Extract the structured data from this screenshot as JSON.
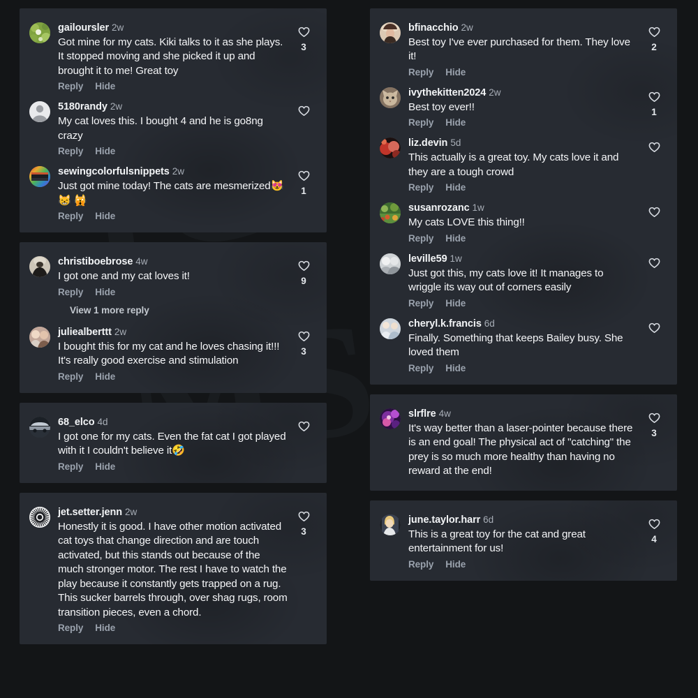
{
  "theme": {
    "page_bg": "#131517",
    "card_bg": "#272b32",
    "text_color": "#f4f5f7",
    "muted_color": "#9aa2ad",
    "username_color": "#f2f4f6"
  },
  "labels": {
    "reply": "Reply",
    "hide": "Hide",
    "view_more_reply": "View 1 more reply",
    "like_icon": "heart-icon"
  },
  "left_column": {
    "cards": [
      {
        "comments": [
          {
            "username": "gailoursler",
            "time": "2w",
            "text": "Got mine for my cats. Kiki talks to it as she plays. It stopped moving and she picked it up and brought it to me! Great toy",
            "likes": "3",
            "avatar": "leaves-photo",
            "has_actions": true
          },
          {
            "username": "5180randy",
            "time": "2w",
            "text": "My cat loves this. I bought 4 and he is go8ng crazy",
            "likes": "",
            "avatar": "default-person",
            "has_actions": true
          },
          {
            "username": "sewingcolorfulsnippets",
            "time": "2w",
            "text": "Just got mine today! The cats are mesmerized😻 😸 🙀",
            "likes": "1",
            "avatar": "rainbow-ring-photo",
            "has_actions": true
          }
        ]
      },
      {
        "comments": [
          {
            "username": "christiboebrose",
            "time": "4w",
            "text": "I got one and my cat loves it!",
            "likes": "9",
            "avatar": "dark-photo",
            "has_actions": true,
            "view_more": true
          },
          {
            "username": "juliealberttt",
            "time": "2w",
            "text": "I bought this for my cat and he loves chasing it!!! It's really good exercise and stimulation",
            "likes": "3",
            "avatar": "couple-photo",
            "has_actions": true
          }
        ]
      },
      {
        "comments": [
          {
            "username": "68_elco",
            "time": "4d",
            "text": "I got one for my cats. Even the fat cat I got played with it I couldn't believe it🤣",
            "likes": "",
            "avatar": "car-photo",
            "has_actions": true
          }
        ]
      },
      {
        "comments": [
          {
            "username": "jet.setter.jenn",
            "time": "2w",
            "text": "Honestly it is good. I have other motion activated cat toys that change direction and are touch activated, but this stands out because of the much stronger motor. The rest I have to watch the play because it constantly gets trapped on a rug. This sucker barrels through, over shag rugs, room transition pieces, even a chord.",
            "likes": "3",
            "avatar": "sunburst-logo",
            "has_actions": true
          }
        ]
      }
    ]
  },
  "right_column": {
    "cards": [
      {
        "comments": [
          {
            "username": "bfinacchio",
            "time": "2w",
            "text": "Best toy I've ever purchased for them. They love it!",
            "likes": "2",
            "avatar": "woman-hat-photo",
            "has_actions": true
          },
          {
            "username": "ivythekitten2024",
            "time": "2w",
            "text": "Best toy ever!!",
            "likes": "1",
            "avatar": "kitten-photo",
            "has_actions": true
          },
          {
            "username": "liz.devin",
            "time": "5d",
            "text": "This actually is a great toy. My cats love it and they are a tough crowd",
            "likes": "",
            "avatar": "red-photo",
            "has_actions": true
          },
          {
            "username": "susanrozanc",
            "time": "1w",
            "text": "My cats LOVE this thing!!",
            "likes": "",
            "avatar": "garden-photo",
            "has_actions": true
          },
          {
            "username": "leville59",
            "time": "1w",
            "text": "Just got this, my cats love it! It manages to wriggle its way out of corners easily",
            "likes": "",
            "avatar": "two-people-photo",
            "has_actions": true
          },
          {
            "username": "cheryl.k.francis",
            "time": "6d",
            "text": "Finally. Something that keeps Bailey busy. She loved them",
            "likes": "",
            "avatar": "couple-light-photo",
            "has_actions": true
          }
        ]
      },
      {
        "comments": [
          {
            "username": "slrflre",
            "time": "4w",
            "text": "It's way better than a laser-pointer because there is an end goal! The physical act of \"catching\" the prey is so much more healthy than having no reward at the end!",
            "likes": "3",
            "avatar": "purple-photo",
            "has_actions": false
          }
        ]
      },
      {
        "comments": [
          {
            "username": "june.taylor.harr",
            "time": "6d",
            "text": "This is a great toy for the cat and great entertainment for us!",
            "likes": "4",
            "avatar": "blonde-photo",
            "has_actions": true
          }
        ]
      }
    ]
  }
}
